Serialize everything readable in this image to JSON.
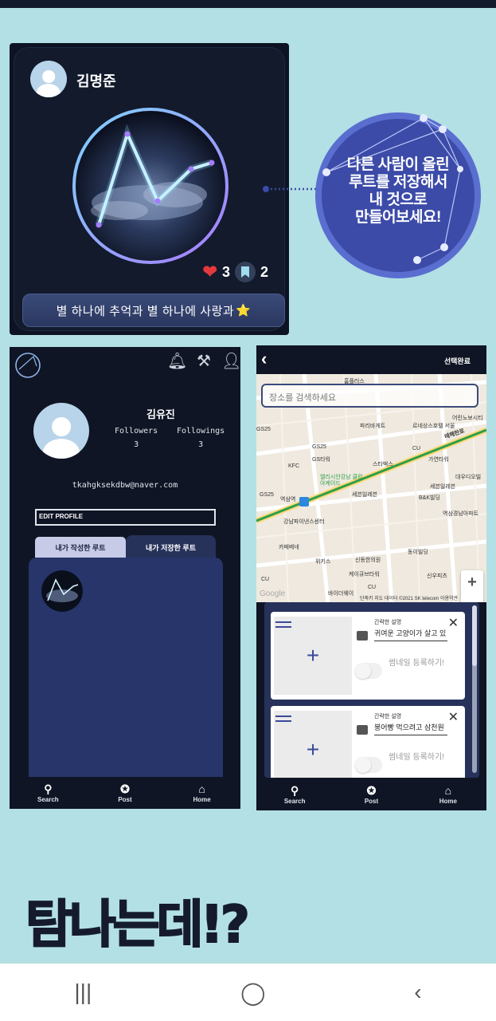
{
  "post_card": {
    "username": "김명준",
    "like_count": "3",
    "save_count": "2",
    "caption": "별 하나에 추억과 별 하나에 사랑과",
    "caption_emoji": "⭐"
  },
  "bubble": {
    "lines": [
      "다른 사람이 올린",
      "루트를 저장해서",
      "내 것으로",
      "만들어보세요!"
    ]
  },
  "profile_screen": {
    "name": "김유진",
    "followers_label": "Followers",
    "followers_count": "3",
    "followings_label": "Followings",
    "followings_count": "3",
    "email": "tkahgksekdbw@naver.com",
    "edit_profile_label": "EDIT PROFILE",
    "tab_my_routes": "내가 작성한 루트",
    "tab_saved_routes": "내가 저장한 루트",
    "icons": [
      "bell-icon",
      "tools-icon",
      "person-icon"
    ]
  },
  "bottom_nav": {
    "search": "Search",
    "post": "Post",
    "home": "Home"
  },
  "map_screen": {
    "done_label": "선택완료",
    "search_placeholder": "장소를 검색하세요",
    "map_labels": [
      "홈플러스",
      "파리바게트",
      "르네상스호텔 서울",
      "어린노보시티",
      "GS25",
      "GS25",
      "GS타워",
      "KFC",
      "스타벅스",
      "CU",
      "가연타워",
      "대우디오빌",
      "역삼역",
      "GS25",
      "세븐일레븐",
      "B&K빌딩",
      "세븐일레븐",
      "강남파이낸스센터",
      "역삼경남아파트",
      "카페베네",
      "위키스",
      "신동한의원",
      "동이빌딩",
      "신우피츠",
      "CU",
      "케이큐브타워",
      "바이더웨이",
      "CU",
      "테헤란로",
      "엘리시안강남 클럽 아케이드",
      "Google",
      "단축키 지도 데이터 ©2021 SK telecom 이용약관"
    ],
    "route_cards": [
      {
        "small_label": "간략한 설명",
        "description": "귀여운 고양이가 살고 있",
        "thumb_label": "썸네일 등록하기!"
      },
      {
        "small_label": "간략한 설명",
        "description": "붕어빵 먹으려고 삼천원",
        "thumb_label": "썸네일 등록하기!"
      }
    ]
  },
  "headline": "탐나는데!?",
  "colors": {
    "page_bg": "#b3e0e4",
    "dark_navy": "#0f1524",
    "panel_blue": "#28356a",
    "bubble_blue": "#3c4ba8",
    "heart_red": "#e3393d"
  }
}
